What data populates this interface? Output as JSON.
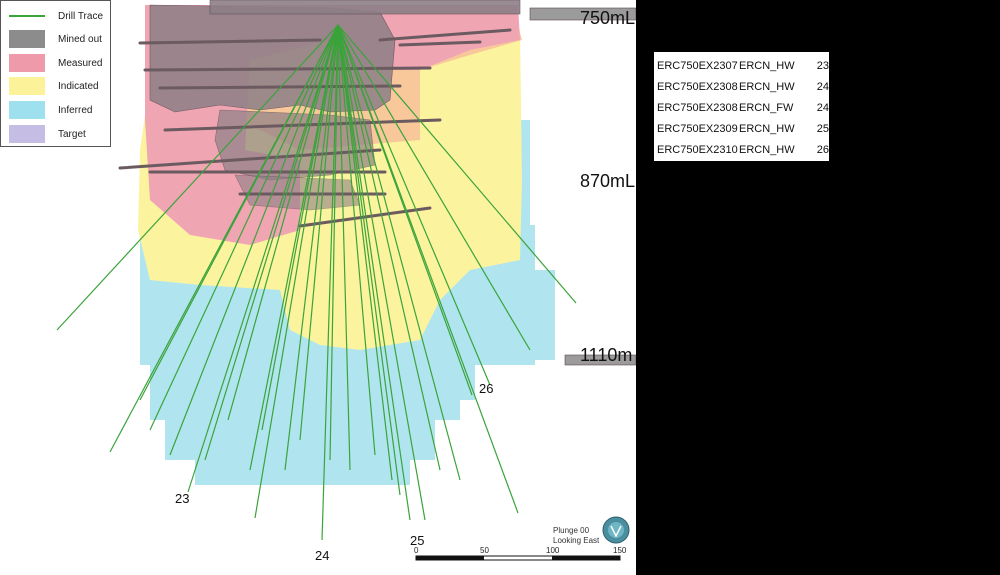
{
  "legend": {
    "items": [
      {
        "label": "Drill Trace",
        "kind": "line",
        "color": "#3aa33a"
      },
      {
        "label": "Mined out",
        "kind": "swatch",
        "color": "#8c8c8c"
      },
      {
        "label": "Measured",
        "kind": "swatch",
        "color": "#ee9aab"
      },
      {
        "label": "Indicated",
        "kind": "swatch",
        "color": "#fbf29a"
      },
      {
        "label": "Inferred",
        "kind": "swatch",
        "color": "#9fe0ee"
      },
      {
        "label": "Target",
        "kind": "swatch",
        "color": "#c5bde3"
      }
    ]
  },
  "levels": {
    "l750": "750mL",
    "l870": "870mL",
    "l1110": "1110m"
  },
  "hole_labels": {
    "h23": "23",
    "h24": "24",
    "h25": "25",
    "h26": "26"
  },
  "scale_bar": {
    "ticks": [
      "0",
      "50",
      "100",
      "150"
    ]
  },
  "orientation": {
    "plunge": "Plunge 00",
    "looking": "Looking East"
  },
  "assay_table": {
    "rows": [
      {
        "hole": "ERC750EX2307",
        "zone": "ERCN_HW",
        "num": "23"
      },
      {
        "hole": "ERC750EX2308",
        "zone": "ERCN_HW",
        "num": "24"
      },
      {
        "hole": "ERC750EX2308",
        "zone": "ERCN_FW",
        "num": "24"
      },
      {
        "hole": "ERC750EX2309",
        "zone": "ERCN_HW",
        "num": "25"
      },
      {
        "hole": "ERC750EX2310",
        "zone": "ERCN_HW",
        "num": "26"
      }
    ]
  },
  "colors": {
    "drill_trace": "#3aa33a",
    "mined_out": "#8c8c8c",
    "measured": "#ee9aab",
    "indicated": "#fbf29a",
    "inferred": "#9fe0ee",
    "orange_overlap": "#f7c79a",
    "background": "#000000",
    "panel": "#ffffff"
  }
}
